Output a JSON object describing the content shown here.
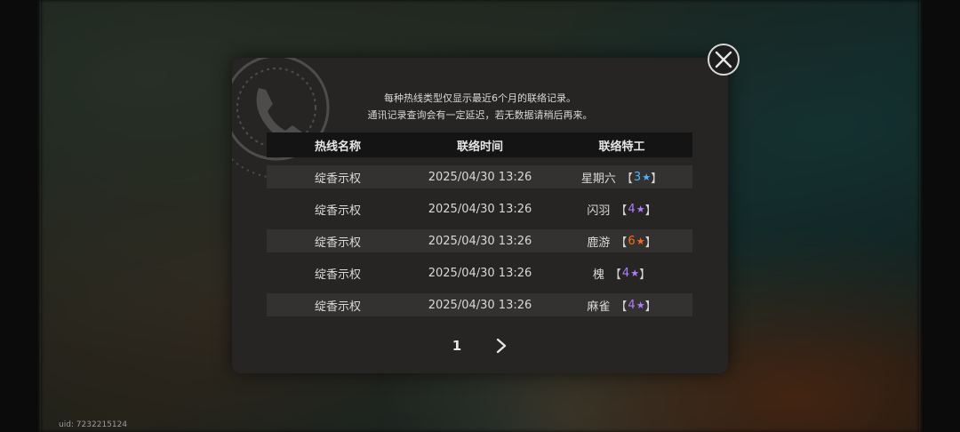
{
  "uid": "uid: 7232215124",
  "notice": {
    "line1": "每种热线类型仅显示最近6个月的联络记录。",
    "line2": "通讯记录查询会有一定延迟，若无数据请稍后再来。"
  },
  "table": {
    "headers": [
      "热线名称",
      "联络时间",
      "联络特工"
    ],
    "rows": [
      {
        "hotline": "绽香示权",
        "time": "2025/04/30 13:26",
        "agent": "星期六",
        "bracket_open": "【",
        "rarity": "3",
        "star": "★",
        "bracket_close": "】",
        "rarity_color": "#4fb3ff"
      },
      {
        "hotline": "绽香示权",
        "time": "2025/04/30 13:26",
        "agent": "闪羽",
        "bracket_open": "【",
        "rarity": "4",
        "star": "★",
        "bracket_close": "】",
        "rarity_color": "#b07cff"
      },
      {
        "hotline": "绽香示权",
        "time": "2025/04/30 13:26",
        "agent": "鹿游",
        "bracket_open": "【",
        "rarity": "6",
        "star": "★",
        "bracket_close": "】",
        "rarity_color": "#ff6a1a"
      },
      {
        "hotline": "绽香示权",
        "time": "2025/04/30 13:26",
        "agent": "槐",
        "bracket_open": "【",
        "rarity": "4",
        "star": "★",
        "bracket_close": "】",
        "rarity_color": "#b07cff"
      },
      {
        "hotline": "绽香示权",
        "time": "2025/04/30 13:26",
        "agent": "麻雀",
        "bracket_open": "【",
        "rarity": "4",
        "star": "★",
        "bracket_close": "】",
        "rarity_color": "#b07cff"
      }
    ]
  },
  "pager": {
    "current_page": "1",
    "next_icon": "chevron-right-icon"
  },
  "close_icon": "close-icon"
}
